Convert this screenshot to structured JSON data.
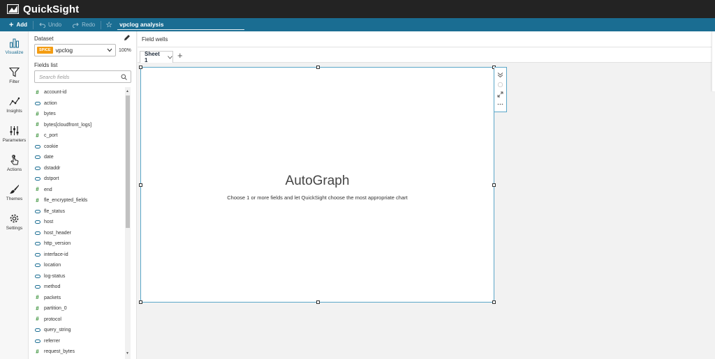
{
  "app": {
    "brand": "QuickSight"
  },
  "toolbar": {
    "add_label": "Add",
    "undo_label": "Undo",
    "redo_label": "Redo",
    "analysis_title": "vpclog analysis"
  },
  "rail": {
    "items": [
      {
        "label": "Visualize",
        "icon": "bar-chart-icon",
        "active": true
      },
      {
        "label": "Filter",
        "icon": "funnel-icon"
      },
      {
        "label": "Insights",
        "icon": "insights-icon"
      },
      {
        "label": "Parameters",
        "icon": "sliders-icon"
      },
      {
        "label": "Actions",
        "icon": "pointer-icon"
      },
      {
        "label": "Themes",
        "icon": "brush-icon"
      },
      {
        "label": "Settings",
        "icon": "gear-icon"
      }
    ]
  },
  "panel": {
    "dataset_label": "Dataset",
    "dataset_badge": "SPICE",
    "dataset_name": "vpclog",
    "dataset_percent": "100%",
    "fields_label": "Fields list",
    "search_placeholder": "Search fields",
    "fields": [
      {
        "name": "account-id",
        "type": "numeric"
      },
      {
        "name": "action",
        "type": "dimension"
      },
      {
        "name": "bytes",
        "type": "numeric"
      },
      {
        "name": "bytes[cloudfront_logs]",
        "type": "numeric"
      },
      {
        "name": "c_port",
        "type": "numeric"
      },
      {
        "name": "cookie",
        "type": "dimension"
      },
      {
        "name": "date",
        "type": "dimension"
      },
      {
        "name": "dstaddr",
        "type": "dimension"
      },
      {
        "name": "dstport",
        "type": "dimension"
      },
      {
        "name": "end",
        "type": "numeric"
      },
      {
        "name": "fle_encrypted_fields",
        "type": "numeric"
      },
      {
        "name": "fle_status",
        "type": "dimension"
      },
      {
        "name": "host",
        "type": "dimension"
      },
      {
        "name": "host_header",
        "type": "dimension"
      },
      {
        "name": "http_version",
        "type": "dimension"
      },
      {
        "name": "interface-id",
        "type": "dimension"
      },
      {
        "name": "location",
        "type": "dimension"
      },
      {
        "name": "log-status",
        "type": "dimension"
      },
      {
        "name": "method",
        "type": "dimension"
      },
      {
        "name": "packets",
        "type": "numeric"
      },
      {
        "name": "partition_0",
        "type": "numeric"
      },
      {
        "name": "protocol",
        "type": "numeric"
      },
      {
        "name": "query_string",
        "type": "dimension"
      },
      {
        "name": "referrer",
        "type": "dimension"
      },
      {
        "name": "request_bytes",
        "type": "numeric"
      }
    ]
  },
  "wells": {
    "label": "Field wells"
  },
  "sheets": {
    "tabs": [
      {
        "label": "Sheet 1"
      }
    ]
  },
  "visual": {
    "title": "AutoGraph",
    "subtitle": "Choose 1 or more fields and let QuickSight choose the most appropriate chart"
  },
  "colors": {
    "topbar": "#232323",
    "toolbar": "#1a6d92",
    "spice_badge": "#f39c12",
    "numeric_field": "#2e8b2e",
    "dimension_field": "#1a6d92",
    "visual_border": "#5aa6c8"
  }
}
